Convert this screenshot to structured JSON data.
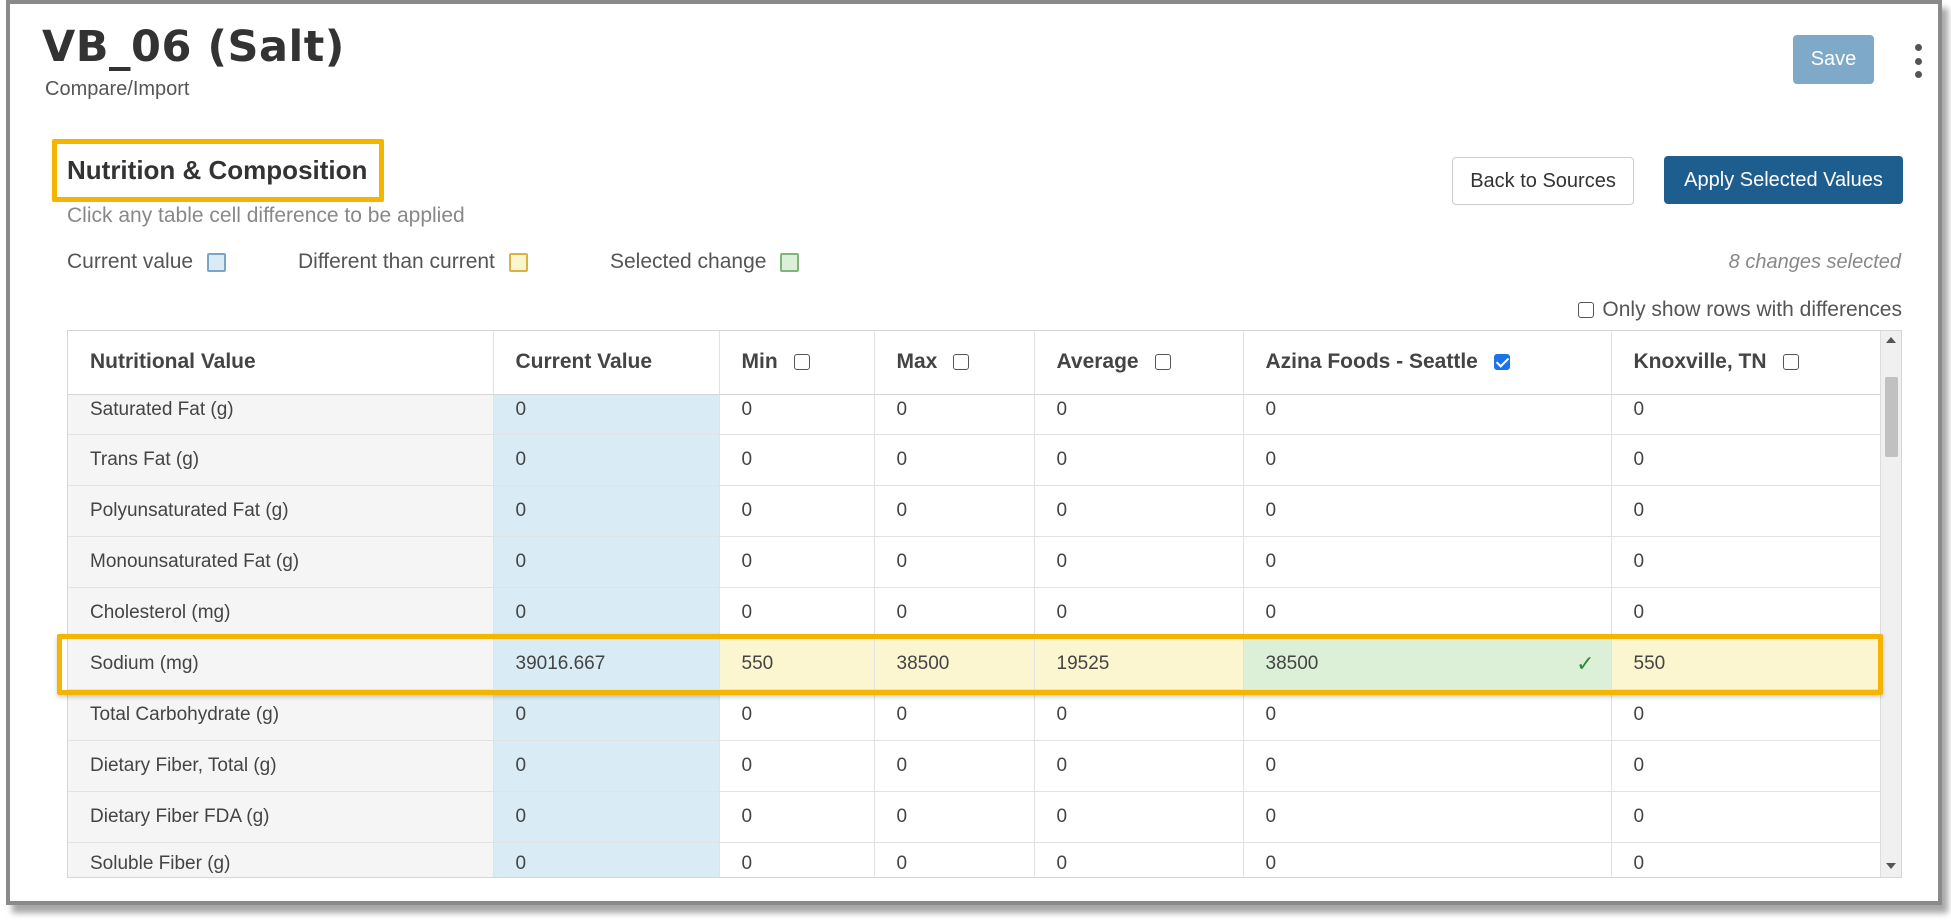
{
  "header": {
    "title": "VB_06 (Salt)",
    "subtitle": "Compare/Import",
    "save_label": "Save"
  },
  "section": {
    "title": "Nutrition & Composition",
    "hint": "Click any table cell difference to be applied",
    "back_label": "Back to Sources",
    "apply_label": "Apply Selected Values",
    "changes_selected": "8 changes selected",
    "only_diff_label": "Only show rows with differences",
    "only_diff_checked": false
  },
  "legend": {
    "current": "Current value",
    "different": "Different than current",
    "selected": "Selected change",
    "colors": {
      "current_fill": "#d9ebf5",
      "current_border": "#7aa6c6",
      "different_fill": "#fcf6d0",
      "different_border": "#d9b43c",
      "selected_fill": "#dcefd7",
      "selected_border": "#7fb57a",
      "highlight": "#f4b400",
      "primary": "#1e5e8e"
    }
  },
  "table": {
    "columns": {
      "name": "Nutritional Value",
      "current": "Current Value",
      "min": "Min",
      "max": "Max",
      "average": "Average",
      "azina": "Azina Foods - Seattle",
      "knox": "Knoxville, TN"
    },
    "column_checked": {
      "min": false,
      "max": false,
      "average": false,
      "azina": true,
      "knox": false
    },
    "rows": [
      {
        "name": "Saturated Fat (g)",
        "current": "0",
        "min": "0",
        "max": "0",
        "average": "0",
        "azina": "0",
        "knox": "0"
      },
      {
        "name": "Trans Fat (g)",
        "current": "0",
        "min": "0",
        "max": "0",
        "average": "0",
        "azina": "0",
        "knox": "0"
      },
      {
        "name": "Polyunsaturated Fat (g)",
        "current": "0",
        "min": "0",
        "max": "0",
        "average": "0",
        "azina": "0",
        "knox": "0"
      },
      {
        "name": "Monounsaturated Fat (g)",
        "current": "0",
        "min": "0",
        "max": "0",
        "average": "0",
        "azina": "0",
        "knox": "0"
      },
      {
        "name": "Cholesterol (mg)",
        "current": "0",
        "min": "0",
        "max": "0",
        "average": "0",
        "azina": "0",
        "knox": "0"
      },
      {
        "name": "Sodium (mg)",
        "current": "39016.667",
        "min": "550",
        "max": "38500",
        "average": "19525",
        "azina": "38500",
        "knox": "550",
        "selected_mark": "✓"
      },
      {
        "name": "Total Carbohydrate (g)",
        "current": "0",
        "min": "0",
        "max": "0",
        "average": "0",
        "azina": "0",
        "knox": "0"
      },
      {
        "name": "Dietary Fiber, Total (g)",
        "current": "0",
        "min": "0",
        "max": "0",
        "average": "0",
        "azina": "0",
        "knox": "0"
      },
      {
        "name": "Dietary Fiber FDA (g)",
        "current": "0",
        "min": "0",
        "max": "0",
        "average": "0",
        "azina": "0",
        "knox": "0"
      },
      {
        "name": "Soluble Fiber (g)",
        "current": "0",
        "min": "0",
        "max": "0",
        "average": "0",
        "azina": "0",
        "knox": "0"
      }
    ]
  }
}
